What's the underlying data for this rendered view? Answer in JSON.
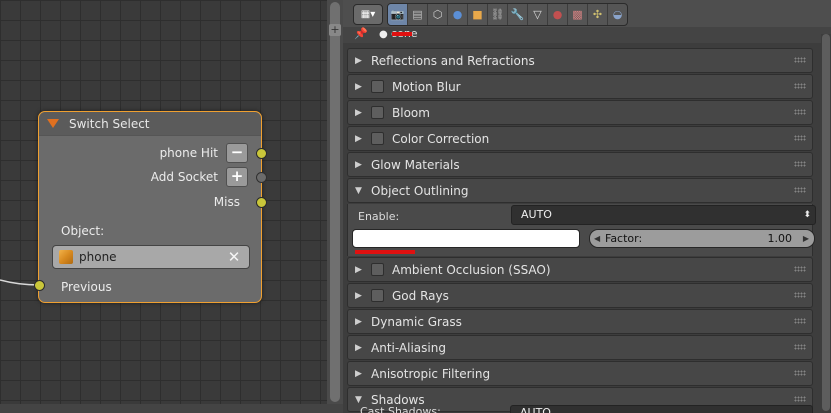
{
  "node": {
    "title": "Switch Select",
    "sockets": [
      {
        "label": "phone Hit",
        "button": "−"
      },
      {
        "label": "Add Socket",
        "button": "+"
      },
      {
        "label": "Miss"
      }
    ],
    "object_label": "Object:",
    "object_value": "phone",
    "clear_glyph": "✕",
    "previous_label": "Previous"
  },
  "properties": {
    "editor_type_glyph": "▦▾",
    "context_tabs": [
      {
        "name": "render-tab",
        "glyph": "📷",
        "color": "#dcdcdc",
        "active": true
      },
      {
        "name": "render-layers-tab",
        "glyph": "▤",
        "color": "#bcbcbc"
      },
      {
        "name": "scene-tab",
        "glyph": "⬡",
        "color": "#cfcfcf"
      },
      {
        "name": "world-tab",
        "glyph": "●",
        "color": "#5b8fd6"
      },
      {
        "name": "object-tab",
        "glyph": "■",
        "color": "#e8a84a"
      },
      {
        "name": "constraints-tab",
        "glyph": "⛓",
        "color": "#b0b0b0"
      },
      {
        "name": "modifiers-tab",
        "glyph": "🔧",
        "color": "#8aa4cc"
      },
      {
        "name": "data-tab",
        "glyph": "▽",
        "color": "#dedede"
      },
      {
        "name": "material-tab",
        "glyph": "●",
        "color": "#c25050"
      },
      {
        "name": "texture-tab",
        "glyph": "▩",
        "color": "#d08080"
      },
      {
        "name": "particles-tab",
        "glyph": "✣",
        "color": "#d0c070"
      },
      {
        "name": "physics-tab",
        "glyph": "◒",
        "color": "#8aa4cc"
      }
    ],
    "pin_glyph": "📌",
    "scene_glyph": "●",
    "scene_name": "cene",
    "panels_top": [
      {
        "label": "Reflections and Refractions",
        "checkbox": false
      },
      {
        "label": "Motion Blur",
        "checkbox": true
      },
      {
        "label": "Bloom",
        "checkbox": true
      },
      {
        "label": "Color Correction",
        "checkbox": true
      },
      {
        "label": "Glow Materials",
        "checkbox": false
      }
    ],
    "outlining": {
      "label": "Object Outlining",
      "enable_label": "Enable:",
      "enable_value": "AUTO",
      "color": "#ffffff",
      "factor_label": "Factor:",
      "factor_value": "1.00"
    },
    "panels_bottom": [
      {
        "label": "Ambient Occlusion (SSAO)",
        "checkbox": true
      },
      {
        "label": "God Rays",
        "checkbox": true
      },
      {
        "label": "Dynamic Grass",
        "checkbox": false
      },
      {
        "label": "Anti-Aliasing",
        "checkbox": false
      },
      {
        "label": "Anisotropic Filtering",
        "checkbox": false
      }
    ],
    "shadows_label": "Shadows",
    "shadows_row_label": "Cast Shadows:",
    "shadows_row_value": "AUTO"
  }
}
